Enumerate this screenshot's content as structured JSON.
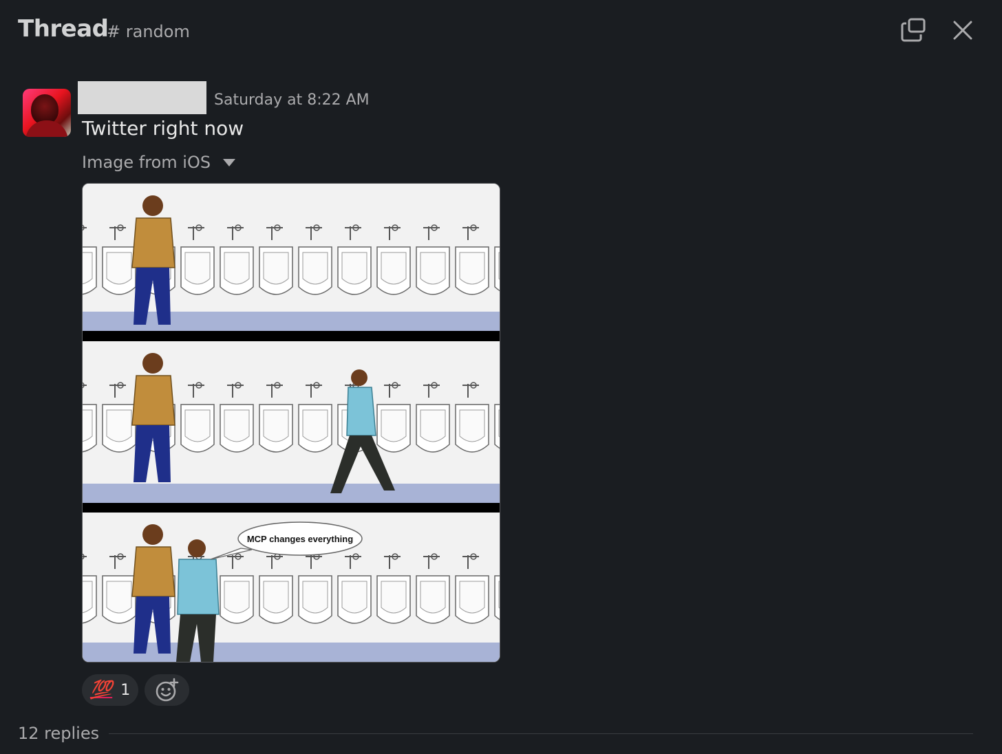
{
  "header": {
    "title": "Thread",
    "channel": "# random"
  },
  "message": {
    "timestamp": "Saturday at 8:22 AM",
    "text": "Twitter right now",
    "attachment_label": "Image from iOS",
    "comic_speech": "MCP changes everything"
  },
  "reactions": [
    {
      "emoji": "100",
      "count": "1"
    }
  ],
  "footer": {
    "replies": "12 replies"
  },
  "colors": {
    "background": "#1a1d21",
    "text": "#d1d2d3",
    "muted": "#ababad",
    "reaction_bg": "#2a2d31"
  },
  "icons": [
    "popout-icon",
    "close-icon",
    "caret-down-icon",
    "add-reaction-icon"
  ]
}
